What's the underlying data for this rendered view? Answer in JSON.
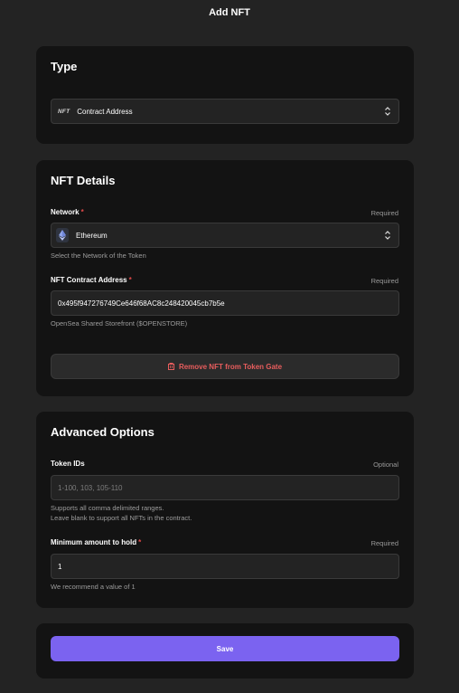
{
  "header": {
    "title": "Add NFT"
  },
  "type_section": {
    "title": "Type",
    "select": {
      "badge": "NFT",
      "value": "Contract Address"
    }
  },
  "nft_details": {
    "title": "NFT Details",
    "network": {
      "label": "Network",
      "required_mark": "*",
      "tag": "Required",
      "value": "Ethereum",
      "icon": "ethereum-icon",
      "helper": "Select the Network of the Token"
    },
    "contract_address": {
      "label": "NFT Contract Address",
      "required_mark": "*",
      "tag": "Required",
      "value": "0x495f947276749Ce646f68AC8c248420045cb7b5e",
      "helper": "OpenSea Shared Storefront ($OPENSTORE)"
    },
    "remove_button": {
      "label": "Remove NFT from Token Gate",
      "icon": "trash-icon"
    }
  },
  "advanced": {
    "title": "Advanced Options",
    "token_ids": {
      "label": "Token IDs",
      "tag": "Optional",
      "placeholder": "1-100, 103, 105-110",
      "helper_line1": "Supports all comma delimited ranges.",
      "helper_line2": "Leave blank to support all NFTs in the contract."
    },
    "min_amount": {
      "label": "Minimum amount to hold",
      "required_mark": "*",
      "tag": "Required",
      "value": "1",
      "helper": "We recommend a value of 1"
    }
  },
  "footer": {
    "save_label": "Save"
  },
  "colors": {
    "background": "#232323",
    "card": "#131313",
    "accent": "#7b63f0",
    "danger": "#e85d5d",
    "required": "#e24a4a"
  }
}
